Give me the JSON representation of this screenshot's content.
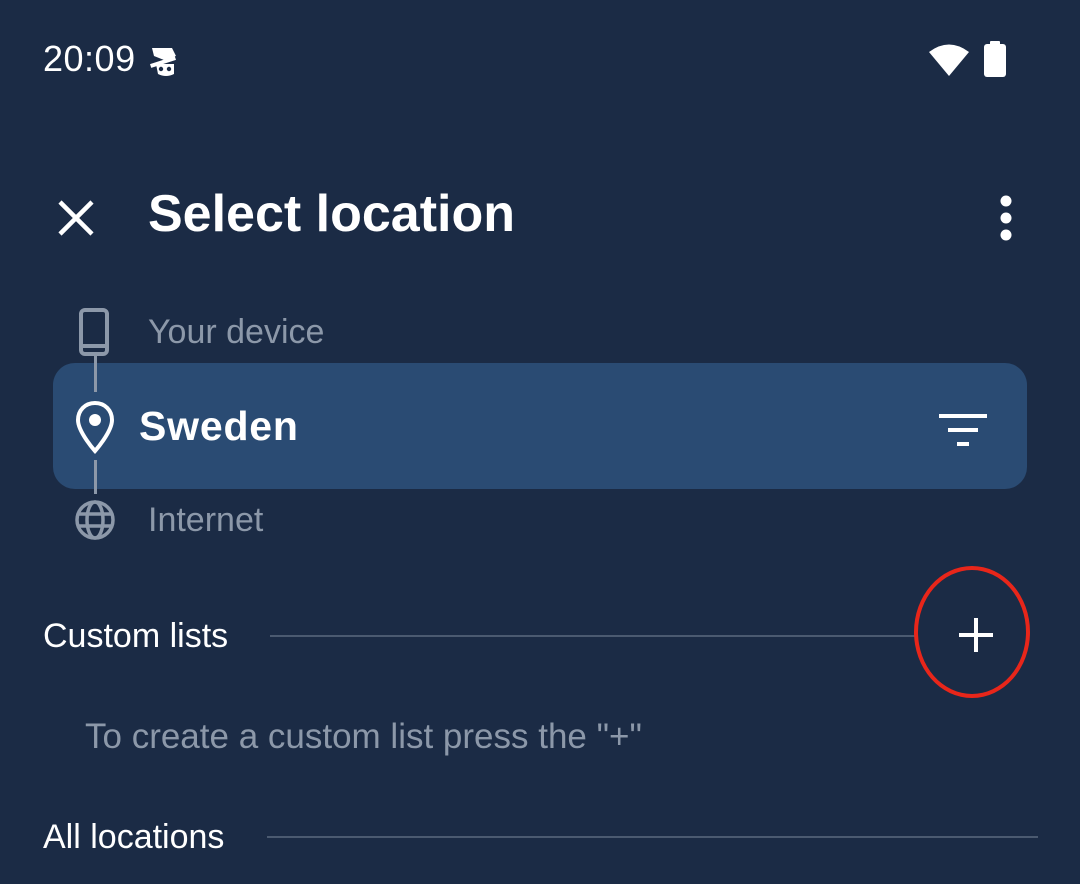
{
  "status_bar": {
    "time": "20:09",
    "icons": [
      "incognito-icon",
      "wifi-icon",
      "battery-icon"
    ]
  },
  "top_bar": {
    "title": "Select location",
    "close_icon": "close-icon",
    "more_icon": "more-vertical-icon"
  },
  "connection_path": {
    "device_label": "Your device",
    "location_label": "Sweden",
    "internet_label": "Internet",
    "filter_icon": "filter-icon"
  },
  "custom_lists": {
    "heading": "Custom lists",
    "hint": "To create a custom list press the \"+\"",
    "add_icon": "plus-icon"
  },
  "all_locations": {
    "heading": "All locations"
  },
  "colors": {
    "background": "#1b2b45",
    "card": "#2a4b73",
    "muted_text": "#8c98a9",
    "highlight": "#e8261a"
  }
}
